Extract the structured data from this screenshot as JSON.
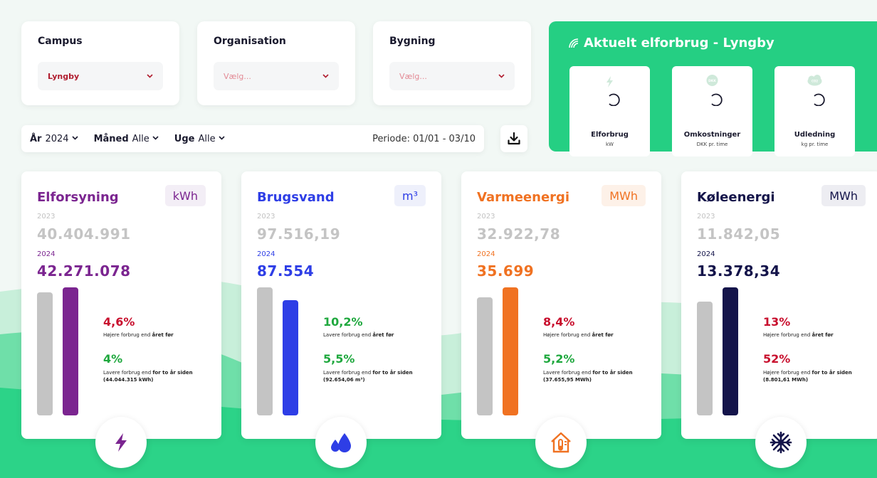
{
  "filters": {
    "campus": {
      "title": "Campus",
      "value": "Lyngby"
    },
    "organisation": {
      "title": "Organisation",
      "placeholder": "Vælg..."
    },
    "bygning": {
      "title": "Bygning",
      "placeholder": "Vælg..."
    }
  },
  "period": {
    "year_label": "År",
    "year_value": "2024",
    "month_label": "Måned",
    "month_value": "Alle",
    "week_label": "Uge",
    "week_value": "Alle",
    "periode_text": "Periode: 01/01 - 03/10"
  },
  "live": {
    "title": "Aktuelt elforbrug - Lyngby",
    "cards": [
      {
        "label": "Elforbrug",
        "unit": "kW",
        "icon": "lightning-icon"
      },
      {
        "label": "Omkostninger",
        "unit": "DKK pr. time",
        "icon": "dkk-coin-icon",
        "icon_text": "DKK"
      },
      {
        "label": "Udledning",
        "unit": "kg pr. time",
        "icon": "co2-cloud-icon",
        "icon_text": "CO2"
      }
    ]
  },
  "stats": [
    {
      "title": "Elforsyning",
      "unit": "kWh",
      "color": "#7b2590",
      "unit_bg": "#f3eef6",
      "year_prev": "2023",
      "value_prev": "40.404.991",
      "year_cur": "2024",
      "value_cur": "42.271.078",
      "bar_prev": 0.96,
      "bar_cur": 1.0,
      "pct1": "4,6%",
      "pct1_color": "red",
      "txt1_a": "Højere forbrug end ",
      "txt1_b": "året før",
      "pct2": "4%",
      "pct2_color": "green",
      "txt2_a": "Lavere forbrug end ",
      "txt2_b": "for to år siden",
      "txt2_c": "(44.044.315 kWh)",
      "icon": "lightning-icon"
    },
    {
      "title": "Brugsvand",
      "unit": "m³",
      "color": "#2e3ee6",
      "unit_bg": "#eef0fb",
      "year_prev": "2023",
      "value_prev": "97.516,19",
      "year_cur": "2024",
      "value_cur": "87.554",
      "bar_prev": 1.0,
      "bar_cur": 0.9,
      "pct1": "10,2%",
      "pct1_color": "green",
      "txt1_a": "Lavere forbrug end ",
      "txt1_b": "året før",
      "pct2": "5,5%",
      "pct2_color": "green",
      "txt2_a": "Lavere forbrug end ",
      "txt2_b": "for to år siden",
      "txt2_c": "(92.654,06 m³)",
      "icon": "water-drops-icon"
    },
    {
      "title": "Varmeenergi",
      "unit": "MWh",
      "color": "#f07222",
      "unit_bg": "#fdf1e8",
      "year_prev": "2023",
      "value_prev": "32.922,78",
      "year_cur": "2024",
      "value_cur": "35.699",
      "bar_prev": 0.92,
      "bar_cur": 1.0,
      "pct1": "8,4%",
      "pct1_color": "red",
      "txt1_a": "Højere forbrug end ",
      "txt1_b": "året før",
      "pct2": "5,2%",
      "pct2_color": "green",
      "txt2_a": "Lavere forbrug end ",
      "txt2_b": "for to år siden",
      "txt2_c": "(37.655,95 MWh)",
      "icon": "house-thermometer-icon"
    },
    {
      "title": "Køleenergi",
      "unit": "MWh",
      "color": "#14144a",
      "unit_bg": "#ededf2",
      "year_prev": "2023",
      "value_prev": "11.842,05",
      "year_cur": "2024",
      "value_cur": "13.378,34",
      "bar_prev": 0.89,
      "bar_cur": 1.0,
      "pct1": "13%",
      "pct1_color": "red",
      "txt1_a": "Højere forbrug end ",
      "txt1_b": "året før",
      "pct2": "52%",
      "pct2_color": "red",
      "txt2_a": "Højere forbrug end ",
      "txt2_b": "for to år siden",
      "txt2_c": "(8.801,61 MWh)",
      "icon": "snowflake-icon"
    }
  ],
  "colors": {
    "accent_green": "#25cf83",
    "wave_light": "#b7ebcf",
    "wave_dark": "#2cd388"
  }
}
